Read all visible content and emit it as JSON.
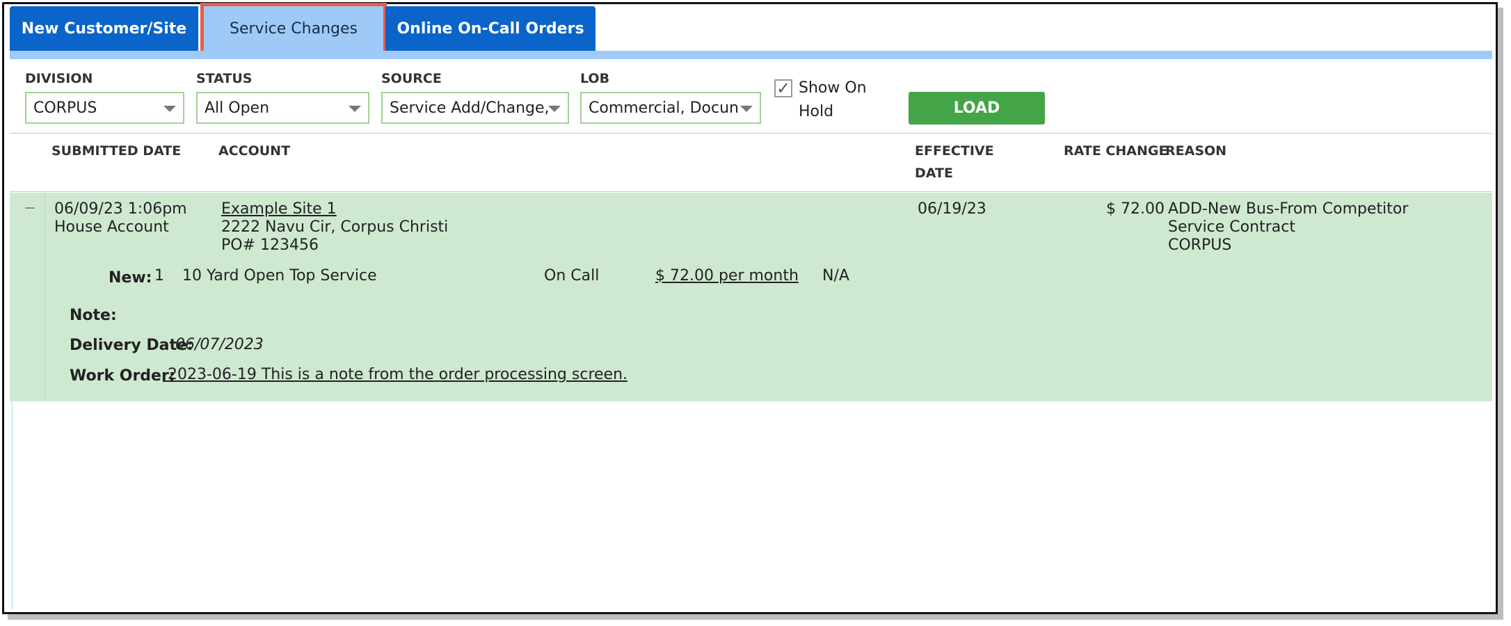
{
  "tabs": [
    {
      "label": "New Customer/Site"
    },
    {
      "label": "Service Changes"
    },
    {
      "label": "Online On-Call Orders"
    }
  ],
  "filters": {
    "division": {
      "label": "DIVISION",
      "value": "CORPUS"
    },
    "status": {
      "label": "STATUS",
      "value": "All Open"
    },
    "source": {
      "label": "SOURCE",
      "value": "Service Add/Change,"
    },
    "lob": {
      "label": "LOB",
      "value": "Commercial, Docun"
    },
    "show_on_hold": {
      "line1": "Show On",
      "line2": "Hold",
      "checked": true,
      "check_glyph": "✓"
    },
    "load_label": "LOAD"
  },
  "columns": {
    "submitted_date": "SUBMITTED DATE",
    "account": "ACCOUNT",
    "effective_date_1": "EFFECTIVE",
    "effective_date_2": "DATE",
    "rate_change": "RATE CHANGE",
    "reason": "REASON"
  },
  "row": {
    "collapse_symbol": "−",
    "submitted": "06/09/23 1:06pm",
    "house": "House Account",
    "account_name": "Example Site 1",
    "address": "2222 Navu Cir, Corpus Christi",
    "po": "PO# 123456",
    "effective": "06/19/23",
    "rate": "$ 72.00",
    "reason_1": "ADD-New Bus-From Competitor",
    "reason_2": "Service Contract",
    "reason_3": "CORPUS",
    "service": {
      "label": "New:",
      "qty": "1",
      "description": "10 Yard Open Top Service",
      "frequency": "On Call",
      "price": "$ 72.00 per month",
      "extra": "N/A"
    },
    "note_label": "Note:",
    "delivery_label": "Delivery Date:",
    "delivery_value": "06/07/2023",
    "work_order_label": "Work Order:",
    "work_order_value": " 2023-06-19 This is a note from the order processing screen."
  },
  "colors": {
    "tab_blue": "#0a64c9",
    "tab_active": "#9fcaf8",
    "row_green": "#cfe9d1",
    "load_green": "#43a548",
    "highlight": "#e85c4a"
  }
}
